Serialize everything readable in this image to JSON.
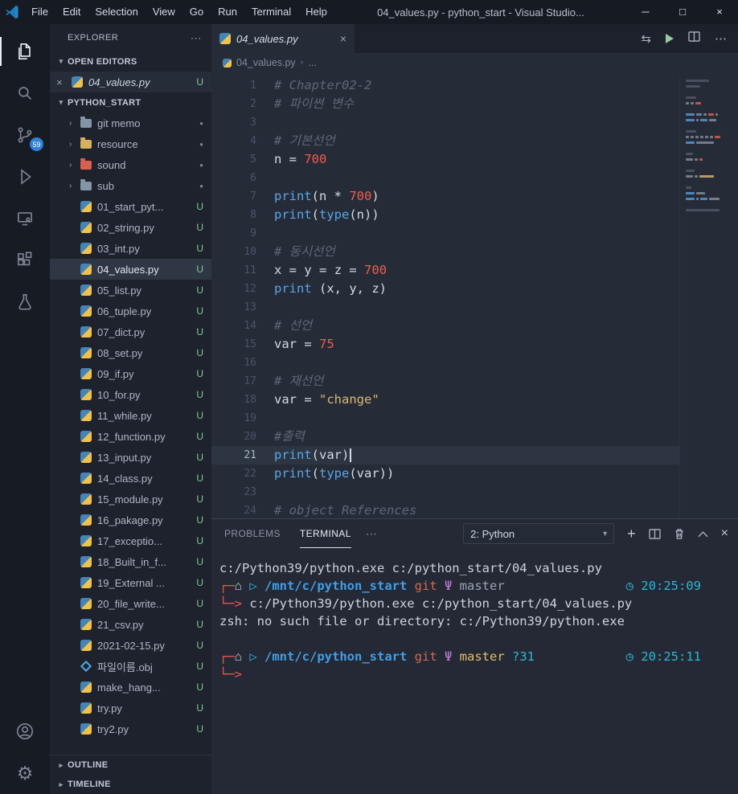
{
  "titlebar": {
    "menus": [
      "File",
      "Edit",
      "Selection",
      "View",
      "Go",
      "Run",
      "Terminal",
      "Help"
    ],
    "title": "04_values.py - python_start - Visual Studio...",
    "controls": {
      "minimize": "─",
      "maximize": "□",
      "close": "×"
    }
  },
  "activitybar": {
    "scm_badge": "59"
  },
  "sidebar": {
    "title": "EXPLORER",
    "more": "⋯",
    "open_editors": {
      "label": "OPEN EDITORS",
      "items": [
        {
          "name": "04_values.py",
          "badge": "U"
        }
      ]
    },
    "project": {
      "label": "PYTHON_START",
      "folders": [
        {
          "name": "git memo",
          "color": "#8296a8"
        },
        {
          "name": "resource",
          "color": "#d8b05e"
        },
        {
          "name": "sound",
          "color": "#d95f4e"
        },
        {
          "name": "sub",
          "color": "#8296a8"
        }
      ],
      "files": [
        {
          "name": "01_start_pyt...",
          "badge": "U",
          "icon": "python"
        },
        {
          "name": "02_string.py",
          "badge": "U",
          "icon": "python"
        },
        {
          "name": "03_int.py",
          "badge": "U",
          "icon": "python"
        },
        {
          "name": "04_values.py",
          "badge": "U",
          "icon": "python",
          "selected": true
        },
        {
          "name": "05_list.py",
          "badge": "U",
          "icon": "python"
        },
        {
          "name": "06_tuple.py",
          "badge": "U",
          "icon": "python"
        },
        {
          "name": "07_dict.py",
          "badge": "U",
          "icon": "python"
        },
        {
          "name": "08_set.py",
          "badge": "U",
          "icon": "python"
        },
        {
          "name": "09_if.py",
          "badge": "U",
          "icon": "python"
        },
        {
          "name": "10_for.py",
          "badge": "U",
          "icon": "python"
        },
        {
          "name": "11_while.py",
          "badge": "U",
          "icon": "python"
        },
        {
          "name": "12_function.py",
          "badge": "U",
          "icon": "python"
        },
        {
          "name": "13_input.py",
          "badge": "U",
          "icon": "python"
        },
        {
          "name": "14_class.py",
          "badge": "U",
          "icon": "python"
        },
        {
          "name": "15_module.py",
          "badge": "U",
          "icon": "python"
        },
        {
          "name": "16_pakage.py",
          "badge": "U",
          "icon": "python"
        },
        {
          "name": "17_exceptio...",
          "badge": "U",
          "icon": "python"
        },
        {
          "name": "18_Built_in_f...",
          "badge": "U",
          "icon": "python"
        },
        {
          "name": "19_External ...",
          "badge": "U",
          "icon": "python"
        },
        {
          "name": "20_file_write...",
          "badge": "U",
          "icon": "python"
        },
        {
          "name": "21_csv.py",
          "badge": "U",
          "icon": "python"
        },
        {
          "name": "2021-02-15.py",
          "badge": "U",
          "icon": "python"
        },
        {
          "name": "파일이름.obj",
          "badge": "U",
          "icon": "obj"
        },
        {
          "name": "make_hang...",
          "badge": "U",
          "icon": "python"
        },
        {
          "name": "try.py",
          "badge": "U",
          "icon": "python"
        },
        {
          "name": "try2.py",
          "badge": "U",
          "icon": "python"
        }
      ]
    },
    "outline_label": "OUTLINE",
    "timeline_label": "TIMELINE"
  },
  "editor": {
    "tab_name": "04_values.py",
    "breadcrumb": "04_values.py",
    "breadcrumb_more": "...",
    "current_line": 21,
    "code_lines": [
      {
        "tokens": [
          [
            "c",
            "# Chapter02-2"
          ]
        ]
      },
      {
        "tokens": [
          [
            "c",
            "# 파이썬 변수"
          ]
        ]
      },
      {
        "tokens": []
      },
      {
        "tokens": [
          [
            "c",
            "# 기본선언"
          ]
        ]
      },
      {
        "tokens": [
          [
            "f",
            "n "
          ],
          [
            "o",
            "= "
          ],
          [
            "n",
            "700"
          ]
        ]
      },
      {
        "tokens": []
      },
      {
        "tokens": [
          [
            "k",
            "print"
          ],
          [
            "f",
            "(n "
          ],
          [
            "o",
            "* "
          ],
          [
            "n",
            "700"
          ],
          [
            "f",
            ")"
          ]
        ]
      },
      {
        "tokens": [
          [
            "k",
            "print"
          ],
          [
            "f",
            "("
          ],
          [
            "k",
            "type"
          ],
          [
            "f",
            "(n))"
          ]
        ]
      },
      {
        "tokens": []
      },
      {
        "tokens": [
          [
            "c",
            "# 동시선언"
          ]
        ]
      },
      {
        "tokens": [
          [
            "f",
            "x "
          ],
          [
            "o",
            "= "
          ],
          [
            "f",
            "y "
          ],
          [
            "o",
            "= "
          ],
          [
            "f",
            "z "
          ],
          [
            "o",
            "= "
          ],
          [
            "n",
            "700"
          ]
        ]
      },
      {
        "tokens": [
          [
            "k",
            "print"
          ],
          [
            "f",
            " (x, y, z)"
          ]
        ]
      },
      {
        "tokens": []
      },
      {
        "tokens": [
          [
            "c",
            "# 선언"
          ]
        ]
      },
      {
        "tokens": [
          [
            "f",
            "var "
          ],
          [
            "o",
            "= "
          ],
          [
            "n",
            "75"
          ]
        ]
      },
      {
        "tokens": []
      },
      {
        "tokens": [
          [
            "c",
            "# 재선언"
          ]
        ]
      },
      {
        "tokens": [
          [
            "f",
            "var "
          ],
          [
            "o",
            "= "
          ],
          [
            "s",
            "\"change\""
          ]
        ]
      },
      {
        "tokens": []
      },
      {
        "tokens": [
          [
            "c",
            "#출력"
          ]
        ]
      },
      {
        "tokens": [
          [
            "k",
            "print"
          ],
          [
            "f",
            "(var)"
          ]
        ],
        "current": true
      },
      {
        "tokens": [
          [
            "k",
            "print"
          ],
          [
            "f",
            "("
          ],
          [
            "k",
            "type"
          ],
          [
            "f",
            "(var))"
          ]
        ]
      },
      {
        "tokens": []
      },
      {
        "tokens": [
          [
            "c",
            "# object References"
          ]
        ]
      }
    ]
  },
  "panel": {
    "tabs": [
      "PROBLEMS",
      "TERMINAL"
    ],
    "active_tab": "TERMINAL",
    "more": "⋯",
    "shell_select": "2: Python",
    "terminal_lines": [
      {
        "left": [
          [
            "fg",
            "c:/Python39/python.exe c:/python_start/04_values.py"
          ]
        ]
      },
      {
        "left": [
          [
            "red",
            "┌─"
          ],
          [
            "muted",
            "⌂ "
          ],
          [
            "cyan",
            "▷ "
          ],
          [
            "path",
            "/mnt/c/python_start"
          ],
          [
            "orange",
            " git "
          ],
          [
            "purple",
            "Ψ "
          ],
          [
            "muted",
            "master"
          ]
        ],
        "right": [
          [
            "cyan",
            "◷ 20:25:09"
          ]
        ]
      },
      {
        "left": [
          [
            "red",
            "└─> "
          ],
          [
            "fg",
            "c:/Python39/python.exe c:/python_start/04_values.py"
          ]
        ]
      },
      {
        "left": [
          [
            "fg",
            "zsh: no such file or directory: c:/Python39/python.exe"
          ]
        ]
      },
      {
        "left": []
      },
      {
        "left": [
          [
            "red",
            "┌─"
          ],
          [
            "muted",
            "⌂ "
          ],
          [
            "cyan",
            "▷ "
          ],
          [
            "path",
            "/mnt/c/python_start"
          ],
          [
            "orange",
            " git "
          ],
          [
            "purple",
            "Ψ "
          ],
          [
            "yellow",
            "master"
          ],
          [
            "cyan",
            " ?31"
          ]
        ],
        "right": [
          [
            "cyan",
            "◷ 20:25:11"
          ]
        ]
      },
      {
        "left": [
          [
            "red",
            "└─>"
          ]
        ]
      }
    ]
  }
}
